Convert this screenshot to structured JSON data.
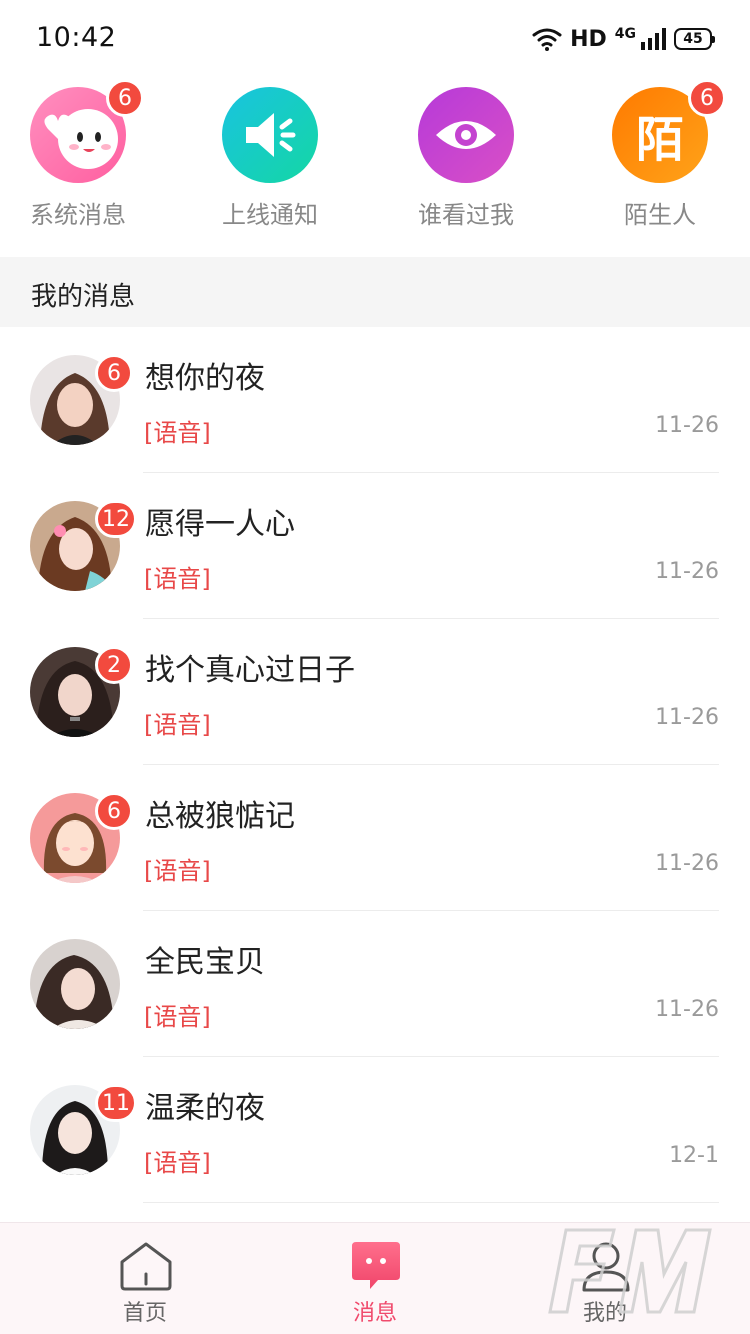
{
  "status_bar": {
    "time": "10:42",
    "hd": "HD",
    "net": "4G",
    "battery": "45"
  },
  "quick_entries": [
    {
      "label": "系统消息",
      "badge": "6",
      "icon": "cute-face-icon"
    },
    {
      "label": "上线通知",
      "badge": "",
      "icon": "speaker-icon"
    },
    {
      "label": "谁看过我",
      "badge": "",
      "icon": "eye-icon"
    },
    {
      "label": "陌生人",
      "badge": "6",
      "icon": "stranger-icon",
      "glyph": "陌"
    }
  ],
  "section": {
    "title": "我的消息"
  },
  "messages": [
    {
      "name": "想你的夜",
      "preview": "[语音]",
      "time": "11-26",
      "badge": "6"
    },
    {
      "name": "愿得一人心",
      "preview": "[语音]",
      "time": "11-26",
      "badge": "12"
    },
    {
      "name": "找个真心过日子",
      "preview": "[语音]",
      "time": "11-26",
      "badge": "2"
    },
    {
      "name": "总被狼惦记",
      "preview": "[语音]",
      "time": "11-26",
      "badge": "6"
    },
    {
      "name": "全民宝贝",
      "preview": "[语音]",
      "time": "11-26",
      "badge": ""
    },
    {
      "name": "温柔的夜",
      "preview": "[语音]",
      "time": "12-1",
      "badge": "11"
    }
  ],
  "tabs": [
    {
      "label": "首页",
      "icon": "home-icon",
      "active": false
    },
    {
      "label": "消息",
      "icon": "chat-icon",
      "active": true
    },
    {
      "label": "我的",
      "icon": "user-icon",
      "active": false
    }
  ],
  "colors": {
    "badge": "#f24a3e",
    "accent": "#f04a6c",
    "preview": "#e84848"
  }
}
